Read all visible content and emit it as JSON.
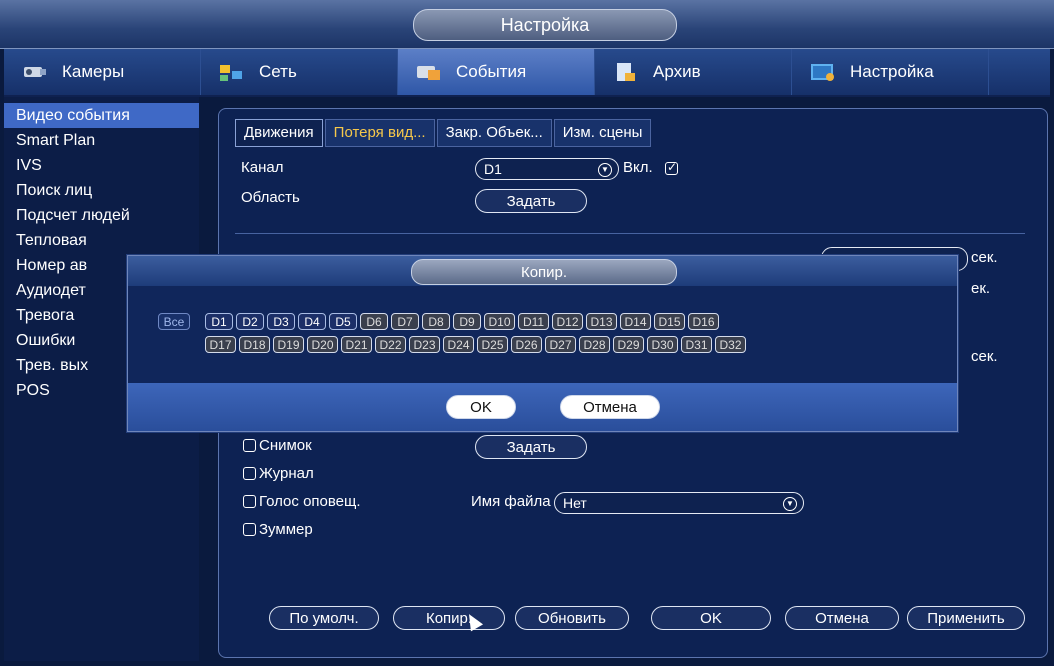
{
  "window": {
    "title": "Настройка"
  },
  "topnav": [
    {
      "label": "Камеры",
      "icon": "camera-icon",
      "active": false
    },
    {
      "label": "Сеть",
      "icon": "network-icon",
      "active": false
    },
    {
      "label": "События",
      "icon": "events-icon",
      "active": true
    },
    {
      "label": "Архив",
      "icon": "archive-icon",
      "active": false
    },
    {
      "label": "Настройка",
      "icon": "settings-icon",
      "active": false
    }
  ],
  "sidebar": {
    "items": [
      {
        "label": "Видео события",
        "active": true
      },
      {
        "label": "Smart Plan"
      },
      {
        "label": "IVS"
      },
      {
        "label": "Поиск лиц"
      },
      {
        "label": "Подсчет людей"
      },
      {
        "label": "Тепловая"
      },
      {
        "label": "Номер ав"
      },
      {
        "label": "Аудиодет"
      },
      {
        "label": "Тревога"
      },
      {
        "label": "Ошибки"
      },
      {
        "label": "Трев. вых"
      },
      {
        "label": "POS"
      }
    ]
  },
  "main": {
    "tabs": [
      "Движения",
      "Потеря вид...",
      "Закр. Объек...",
      "Изм. сцены"
    ],
    "channel_label": "Канал",
    "channel_value": "D1",
    "enable_label": "Вкл.",
    "area_label": "Область",
    "area_button": "Задать",
    "sec_label": "сек.",
    "sec_label_2": "ек.",
    "snapshot_label": "Снимок",
    "snapshot_button": "Задать",
    "journal_label": "Журнал",
    "voice_label": "Голос оповещ.",
    "file_name_label": "Имя файла",
    "file_name_value": "Нет",
    "buzzer_label": "Зуммер",
    "buttons": {
      "default": "По умолч.",
      "copy": "Копир.",
      "refresh": "Обновить",
      "ok": "OK",
      "cancel": "Отмена",
      "apply": "Применить"
    }
  },
  "copy_dialog": {
    "title": "Копир.",
    "all_label": "Все",
    "channels_row1": [
      "D1",
      "D2",
      "D3",
      "D4",
      "D5",
      "D6",
      "D7",
      "D8",
      "D9",
      "D10",
      "D11",
      "D12",
      "D13",
      "D14",
      "D15",
      "D16"
    ],
    "channels_row2": [
      "D17",
      "D18",
      "D19",
      "D20",
      "D21",
      "D22",
      "D23",
      "D24",
      "D25",
      "D26",
      "D27",
      "D28",
      "D29",
      "D30",
      "D31",
      "D32"
    ],
    "selected": [
      "D1",
      "D2",
      "D3",
      "D4",
      "D5"
    ],
    "ok": "OK",
    "cancel": "Отмена"
  }
}
